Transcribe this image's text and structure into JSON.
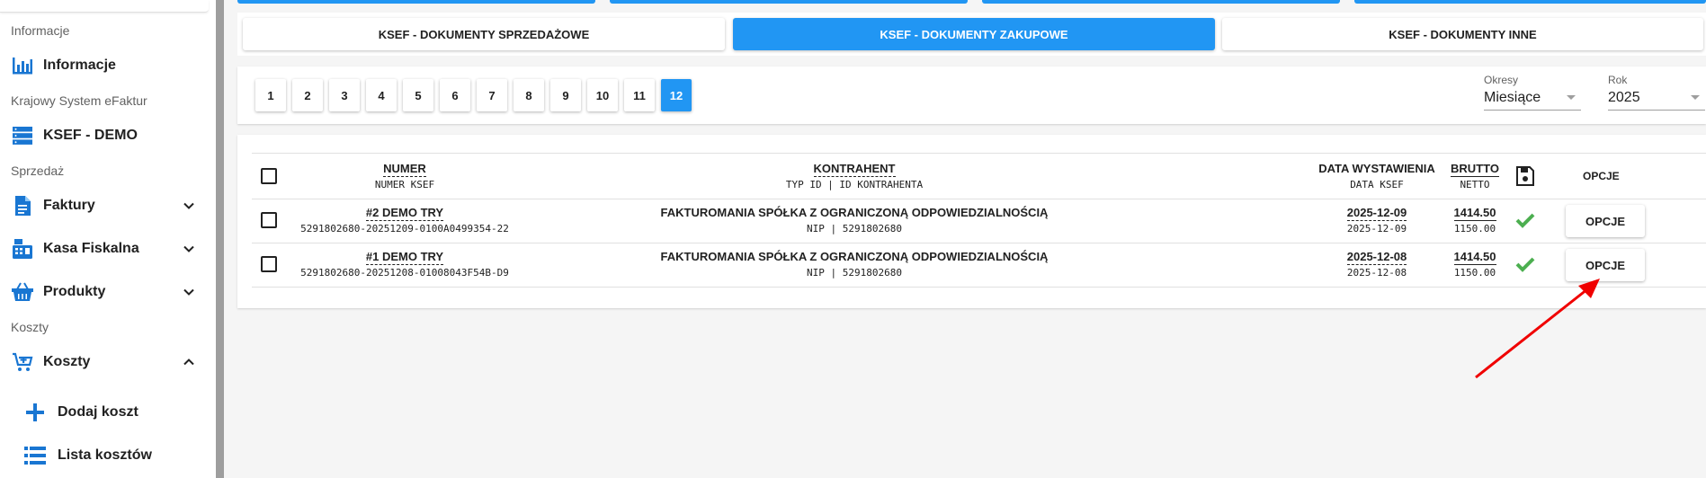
{
  "sidebar": {
    "sections": {
      "info": "Informacje",
      "ksef": "Krajowy System eFaktur",
      "sales": "Sprzedaż",
      "costs": "Koszty"
    },
    "items": {
      "informacje": "Informacje",
      "ksef_demo": "KSEF - DEMO",
      "faktury": "Faktury",
      "kasa": "Kasa Fiskalna",
      "produkty": "Produkty",
      "koszty": "Koszty",
      "dodaj_koszt": "Dodaj koszt",
      "lista_kosztow": "Lista kosztów"
    }
  },
  "tabs": {
    "sales": "KSEF - DOKUMENTY SPRZEDAŻOWE",
    "purchases": "KSEF - DOKUMENTY ZAKUPOWE",
    "other": "KSEF - DOKUMENTY INNE"
  },
  "pager": {
    "pages": [
      "1",
      "2",
      "3",
      "4",
      "5",
      "6",
      "7",
      "8",
      "9",
      "10",
      "11",
      "12"
    ],
    "active": "12"
  },
  "filters": {
    "period_label": "Okresy",
    "period_value": "Miesiące",
    "year_label": "Rok",
    "year_value": "2025"
  },
  "table": {
    "headers": {
      "numer": "NUMER",
      "numer_ksef": "NUMER KSEF",
      "kontrahent": "KONTRAHENT",
      "typ_id": "TYP ID | ID KONTRAHENTA",
      "data_wyst": "DATA WYSTAWIENIA",
      "data_ksef": "DATA KSEF",
      "brutto": "BRUTTO",
      "netto": "NETTO",
      "opcje": "OPCJE"
    },
    "rows": [
      {
        "numer": "#2 DEMO TRY",
        "numer_ksef": "5291802680-20251209-0100A0499354-22",
        "kontrahent": "FAKTUROMANIA SPÓŁKA Z OGRANICZONĄ ODPOWIEDZIALNOŚCIĄ",
        "typ_id": "NIP | 5291802680",
        "data_wyst": "2025-12-09",
        "data_ksef": "2025-12-09",
        "brutto": "1414.50",
        "netto": "1150.00",
        "opcje": "OPCJE"
      },
      {
        "numer": "#1 DEMO TRY",
        "numer_ksef": "5291802680-20251208-01008043F54B-D9",
        "kontrahent": "FAKTUROMANIA SPÓŁKA Z OGRANICZONĄ ODPOWIEDZIALNOŚCIĄ",
        "typ_id": "NIP | 5291802680",
        "data_wyst": "2025-12-08",
        "data_ksef": "2025-12-08",
        "brutto": "1414.50",
        "netto": "1150.00",
        "opcje": "OPCJE"
      }
    ]
  },
  "colors": {
    "accent": "#2196f3",
    "check": "#4caf50",
    "annotation": "#f00000"
  }
}
